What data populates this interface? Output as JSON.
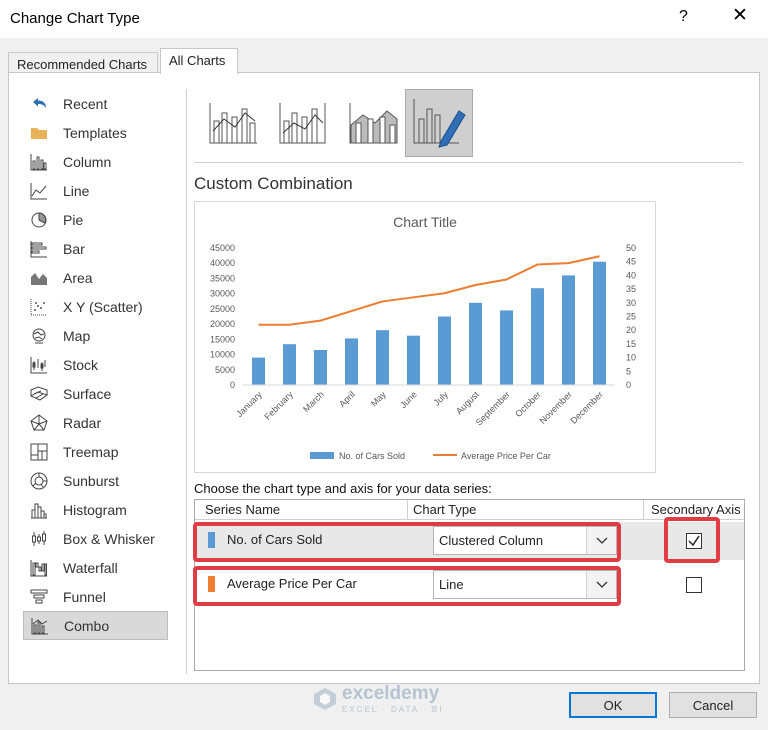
{
  "window": {
    "title": "Change Chart Type",
    "help_glyph": "?",
    "close_glyph": "✕"
  },
  "tabs": [
    {
      "label": "Recommended Charts",
      "selected": false
    },
    {
      "label": "All Charts",
      "selected": true
    }
  ],
  "sidebar": {
    "items": [
      {
        "label": "Recent",
        "icon": "undo-icon"
      },
      {
        "label": "Templates",
        "icon": "folder-icon"
      },
      {
        "label": "Column",
        "icon": "column-chart-icon"
      },
      {
        "label": "Line",
        "icon": "line-chart-icon"
      },
      {
        "label": "Pie",
        "icon": "pie-chart-icon"
      },
      {
        "label": "Bar",
        "icon": "bar-chart-icon"
      },
      {
        "label": "Area",
        "icon": "area-chart-icon"
      },
      {
        "label": "X Y (Scatter)",
        "icon": "scatter-chart-icon"
      },
      {
        "label": "Map",
        "icon": "map-chart-icon"
      },
      {
        "label": "Stock",
        "icon": "stock-chart-icon"
      },
      {
        "label": "Surface",
        "icon": "surface-chart-icon"
      },
      {
        "label": "Radar",
        "icon": "radar-chart-icon"
      },
      {
        "label": "Treemap",
        "icon": "treemap-chart-icon"
      },
      {
        "label": "Sunburst",
        "icon": "sunburst-chart-icon"
      },
      {
        "label": "Histogram",
        "icon": "histogram-chart-icon"
      },
      {
        "label": "Box & Whisker",
        "icon": "box-whisker-chart-icon"
      },
      {
        "label": "Waterfall",
        "icon": "waterfall-chart-icon"
      },
      {
        "label": "Funnel",
        "icon": "funnel-chart-icon"
      },
      {
        "label": "Combo",
        "icon": "combo-chart-icon",
        "selected": true
      }
    ]
  },
  "combo_variants": [
    {
      "icon": "clustered-column-line-icon",
      "selected": false
    },
    {
      "icon": "clustered-column-line-secondary-icon",
      "selected": false
    },
    {
      "icon": "stacked-area-column-icon",
      "selected": false
    },
    {
      "icon": "custom-combination-icon",
      "selected": true
    }
  ],
  "section_heading": "Custom Combination",
  "chart_data": {
    "type": "bar",
    "title": "Chart Title",
    "categories": [
      "January",
      "February",
      "March",
      "April",
      "May",
      "June",
      "July",
      "August",
      "September",
      "October",
      "November",
      "December"
    ],
    "series": [
      {
        "name": "No. of Cars Sold",
        "type": "bar",
        "axis": "primary",
        "color": "#5b9bd5",
        "values": [
          9000,
          13400,
          11500,
          15300,
          18000,
          16200,
          22500,
          27000,
          24500,
          31800,
          36000,
          40500
        ]
      },
      {
        "name": "Average Price Per Car",
        "type": "line",
        "axis": "secondary",
        "color": "#ed7d31",
        "values": [
          22,
          22,
          23.5,
          27,
          30.5,
          32,
          33.5,
          36.5,
          38.5,
          44,
          44.5,
          47
        ]
      }
    ],
    "ylim": [
      0,
      45000
    ],
    "y_ticks": [
      0,
      5000,
      10000,
      15000,
      20000,
      25000,
      30000,
      35000,
      40000,
      45000
    ],
    "y2lim": [
      0,
      50
    ],
    "y2_ticks": [
      0,
      5,
      10,
      15,
      20,
      25,
      30,
      35,
      40,
      45,
      50
    ],
    "legend_position": "bottom",
    "grid": false
  },
  "series_section": {
    "prompt": "Choose the chart type and axis for your data series:",
    "headers": {
      "name": "Series Name",
      "type": "Chart Type",
      "axis": "Secondary Axis"
    },
    "rows": [
      {
        "name": "No. of Cars Sold",
        "color": "#5b9bd5",
        "chart_type": "Clustered Column",
        "secondary_axis": true
      },
      {
        "name": "Average Price Per Car",
        "color": "#ed7d31",
        "chart_type": "Line",
        "secondary_axis": false
      }
    ]
  },
  "watermark": {
    "name": "exceldemy",
    "tagline": "EXCEL · DATA · BI"
  },
  "buttons": {
    "ok": "OK",
    "cancel": "Cancel"
  },
  "accent_color": "#e03c46"
}
